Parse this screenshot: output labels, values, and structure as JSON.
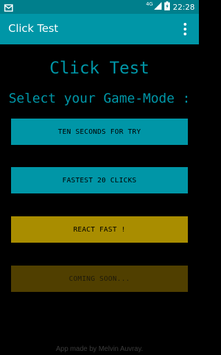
{
  "status_bar": {
    "network": "4G",
    "time": "22:28",
    "color": "#007f8c"
  },
  "app_bar": {
    "title": "Click Test",
    "color": "#0096a7"
  },
  "main": {
    "heading": "Click Test",
    "subheading": "Select your Game-Mode :",
    "buttons": [
      {
        "label": "TEN SECONDS FOR TRY",
        "color": "#0096a7"
      },
      {
        "label": "FASTEST 20 CLICKS",
        "color": "#0096a7"
      },
      {
        "label": "REACT FAST !",
        "color": "#a98d00"
      },
      {
        "label": "COMING SOON...",
        "color": "#503f00"
      }
    ]
  },
  "footer": {
    "credit": "App made by Melvin Auvray."
  }
}
